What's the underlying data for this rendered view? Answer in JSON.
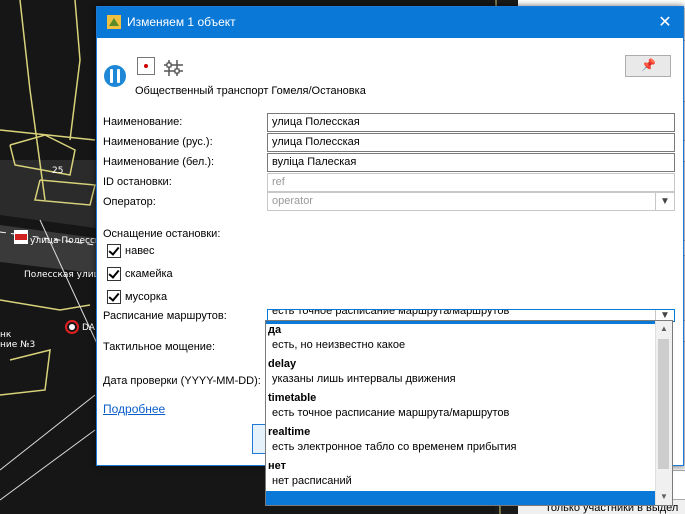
{
  "dialog": {
    "title": "Изменяем 1 объект",
    "close_glyph": "✕",
    "pin_glyph": "📌",
    "preset_name": "Общественный транспорт Гомеля/Остановка"
  },
  "fields": {
    "name_label": "Наименование:",
    "name_value": "улица Полесская",
    "name_ru_label": "Наименование (рус.):",
    "name_ru_value": "улица Полесская",
    "name_be_label": "Наименование (бел.):",
    "name_be_value": "вуліца Палеская",
    "stop_id_label": "ID остановки:",
    "stop_id_value": "ref",
    "operator_label": "Оператор:",
    "operator_value": "operator",
    "equipment_label": "Оснащение остановки:",
    "schedule_label": "Расписание маршрутов:",
    "schedule_value": "есть точное расписание маршрута/маршрутов",
    "tactile_label": "Тактильное мощение:",
    "check_date_label": "Дата проверки (YYYY-MM-DD):"
  },
  "checkboxes": [
    {
      "label": "навес",
      "checked": true
    },
    {
      "label": "скамейка",
      "checked": true
    },
    {
      "label": "мусорка",
      "checked": true
    }
  ],
  "more_link": "Подробнее",
  "dropdown_options": [
    {
      "key": "да",
      "desc": "есть, но неизвестно какое"
    },
    {
      "key": "delay",
      "desc": "указаны лишь интервалы движения"
    },
    {
      "key": "timetable",
      "desc": "есть точное расписание маршрута/маршрутов"
    },
    {
      "key": "realtime",
      "desc": "есть электронное табло со временем прибытия"
    },
    {
      "key": "нет",
      "desc": "нет расписаний"
    }
  ],
  "map_labels": {
    "street1": "улица Полесская",
    "street2": "Полесская улица",
    "number": "25",
    "frag1": "DA",
    "frag2": "нк",
    "frag3": "ние №3"
  },
  "right_panel_text": "Только участники в выдел",
  "colors": {
    "accent": "#0a78d7",
    "link": "#0b5ec9"
  }
}
